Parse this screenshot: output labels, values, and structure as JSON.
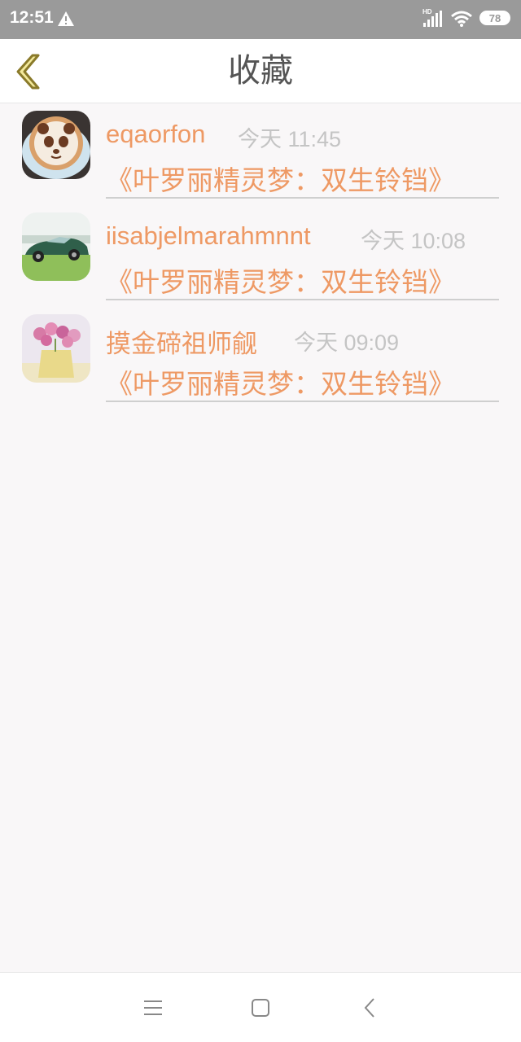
{
  "status_bar": {
    "time": "12:51",
    "network_label": "HD",
    "battery": "78",
    "icons": [
      "warning-icon",
      "signal-icon",
      "wifi-icon",
      "battery-icon"
    ]
  },
  "header": {
    "title": "收藏",
    "back_icon": "chevron-left-icon"
  },
  "items": [
    {
      "name": "eqaorfon",
      "time": "今天 11:45",
      "book": "《叶罗丽精灵梦：双生铃铛》",
      "avatar": "panda-latte-avatar"
    },
    {
      "name": "iisabjelmarahmnnt",
      "time": "今天 10:08",
      "book": "《叶罗丽精灵梦：双生铃铛》",
      "avatar": "green-car-avatar"
    },
    {
      "name": "摸金碲祖师觎",
      "time": "今天 09:09",
      "book": "《叶罗丽精灵梦：双生铃铛》",
      "avatar": "flower-vase-avatar"
    }
  ],
  "nav_bar": {
    "icons": [
      "menu-icon",
      "home-icon",
      "back-icon"
    ]
  },
  "colors": {
    "accent": "#ee9964",
    "time_text": "#c4c4c4",
    "title_text": "#555555",
    "status_bar_bg": "#9a9a9a",
    "back_chevron_fill": "#f4ea9c",
    "back_chevron_stroke": "#8a7a2a",
    "page_bg": "#f9f7f8"
  }
}
